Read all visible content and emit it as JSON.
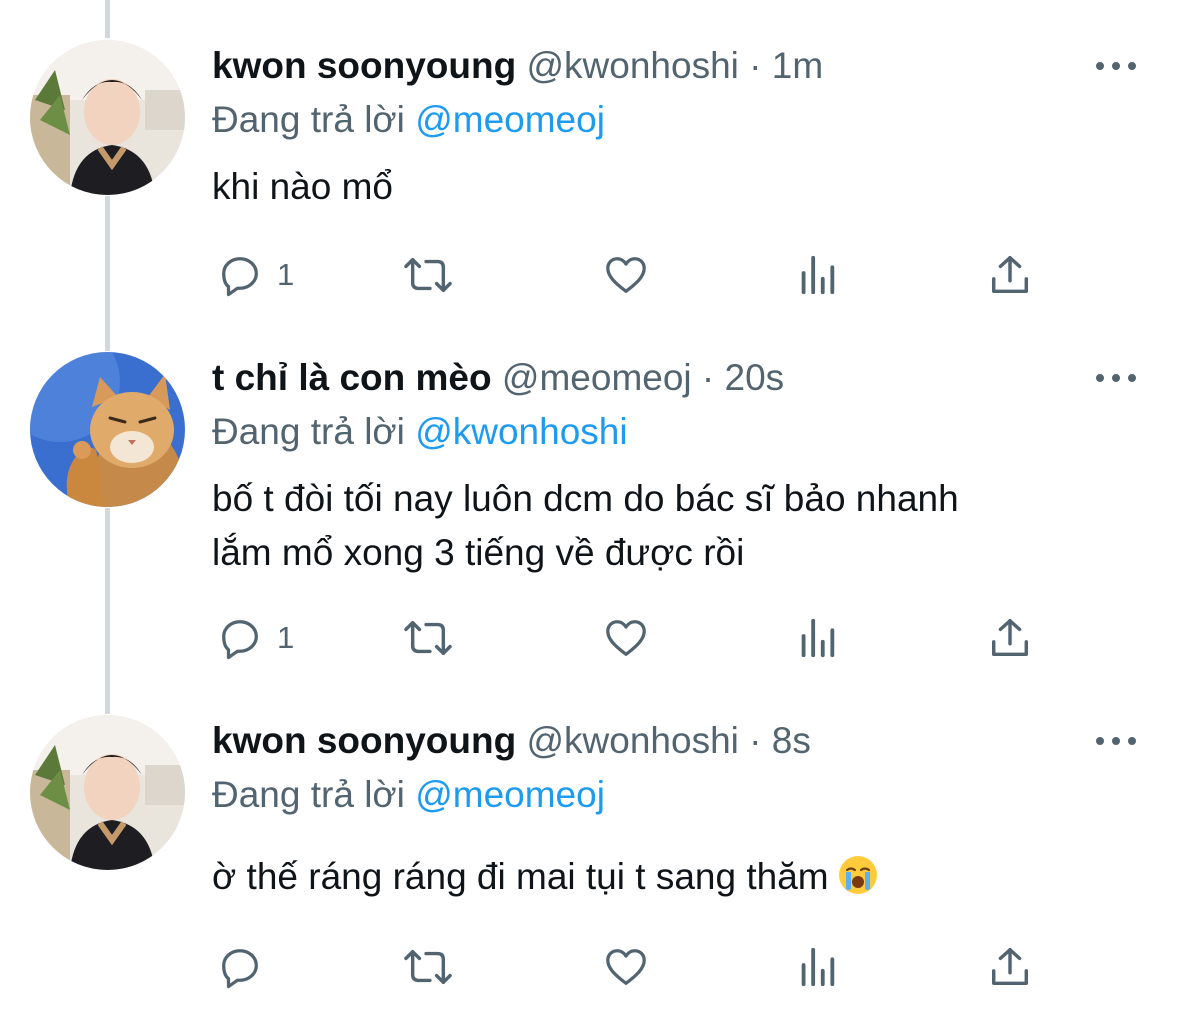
{
  "colors": {
    "accent": "#1d9bf0",
    "secondary": "#536471",
    "text": "#0f1419",
    "thread_line": "#cfd9de"
  },
  "tweets": [
    {
      "author": "kwon soonyoung",
      "handle": "@kwonhoshi",
      "separator": "·",
      "time": "1m",
      "reply_prefix": "Đang trả lời",
      "reply_to": "@meomeoj",
      "text": "khi nào mổ",
      "reply_count": "1",
      "avatar": "person-avatar"
    },
    {
      "author": "t chỉ là con mèo",
      "handle": "@meomeoj",
      "separator": "·",
      "time": "20s",
      "reply_prefix": "Đang trả lời",
      "reply_to": "@kwonhoshi",
      "text_line1": "bố t đòi tối nay luôn dcm do bác sĩ bảo nhanh",
      "text_line2": "lắm mổ xong 3 tiếng về được rồi",
      "reply_count": "1",
      "avatar": "cat-avatar"
    },
    {
      "author": "kwon soonyoung",
      "handle": "@kwonhoshi",
      "separator": "·",
      "time": "8s",
      "reply_prefix": "Đang trả lời",
      "reply_to": "@meomeoj",
      "text": "ờ thế ráng ráng đi mai tụi t sang thăm",
      "emoji": "loudly-crying-face",
      "reply_count": "",
      "avatar": "person-avatar"
    }
  ]
}
